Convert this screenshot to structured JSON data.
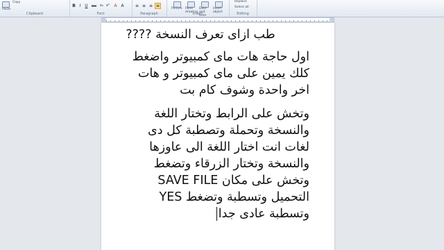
{
  "ribbon": {
    "clipboard": {
      "paste": "Paste",
      "copy": "Copy",
      "label": "Clipboard"
    },
    "font": {
      "label": "Font",
      "bold": "B",
      "italic": "I",
      "underline": "U",
      "strike": "abc",
      "sub": "x₂",
      "sup": "x²",
      "color": "A"
    },
    "paragraph": {
      "label": "Paragraph"
    },
    "insert": {
      "label": "Insert",
      "picture": "Picture",
      "paint_drawing": "Paint drawing",
      "date_time": "Date and time",
      "insert_object": "Insert object"
    },
    "editing": {
      "label": "Editing",
      "replace": "Replace",
      "select_all": "Select all"
    }
  },
  "document": {
    "title": "طب ازاى تعرف النسخة ????",
    "paragraphs": [
      [
        "اول حاجة هات ماى كمبيوتر واضغط",
        "كلك يمين على ماى كمبيوتر و هات",
        "اخر واحدة وشوف كام بت"
      ],
      [
        "وتخش على الرابط وتختار اللغة",
        "والنسخة وتحملة وتصطبة كل دى",
        "لغات انت اختار اللغة الى  عاوزها",
        "والنسخة وتختار الزرقاء وتضغط",
        "وتخش على مكان  SAVE FILE",
        "التحميل وتسطبة وتضغط  YES",
        "وتسطبة عادى جدا"
      ]
    ]
  }
}
